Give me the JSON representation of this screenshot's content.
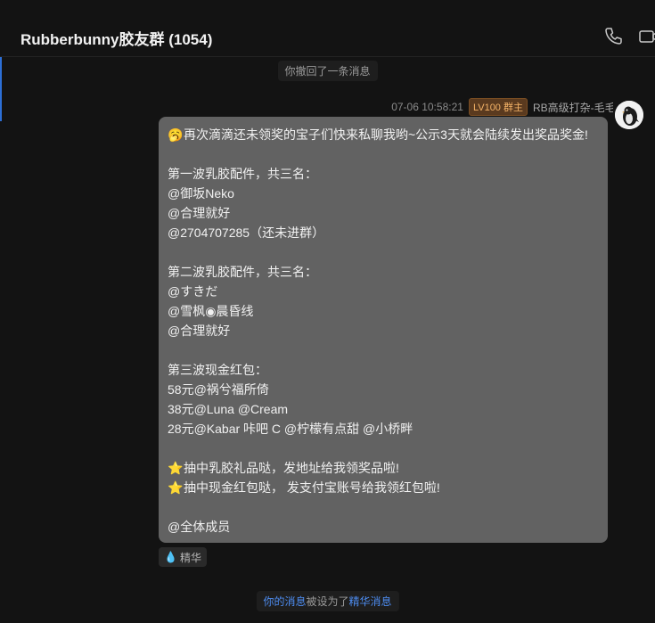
{
  "header": {
    "title": "Rubberbunny胶友群 (1054)",
    "phone_icon": "phone-icon",
    "video_icon": "video-icon"
  },
  "notices": {
    "recall_text": "你撤回了一条消息",
    "essence_prefix": "你的消息",
    "essence_mid": "被设为了",
    "essence_link": "精华消息"
  },
  "message": {
    "timestamp": "07-06 10:58:21",
    "level_badge": "LV100 群主",
    "sender": "RB高级打杂-毛毛",
    "lines": [
      {
        "emoji": "🥱",
        "text": "再次滴滴还未领奖的宝子们快来私聊我哟~公示3天就会陆续发出奖品奖金!"
      },
      {
        "text": ""
      },
      {
        "text": "第一波乳胶配件，共三名："
      },
      {
        "text": "@御坂Neko"
      },
      {
        "text": "@合理就好"
      },
      {
        "text": "@2704707285（还未进群）"
      },
      {
        "text": ""
      },
      {
        "text": "第二波乳胶配件，共三名："
      },
      {
        "text": "@すきだ"
      },
      {
        "text": "@雪枫◉晨昏线"
      },
      {
        "text": "@合理就好"
      },
      {
        "text": ""
      },
      {
        "text": "第三波现金红包："
      },
      {
        "text": "58元@祸兮福所倚"
      },
      {
        "text": "38元@Luna @Cream"
      },
      {
        "text": "28元@Kabar 咔吧 C @柠檬有点甜 @小桥畔"
      },
      {
        "text": ""
      },
      {
        "emoji": "⭐",
        "text": "抽中乳胶礼品哒，发地址给我领奖品啦!"
      },
      {
        "emoji": "⭐",
        "text": "抽中现金红包哒， 发支付宝账号给我领红包啦!"
      },
      {
        "text": ""
      },
      {
        "text": "@全体成员"
      }
    ],
    "essence_tag": "精华"
  },
  "colors": {
    "background": "#131313",
    "bubble": "#626262",
    "accent_blue": "#4d8cf0",
    "badge_bg": "#5a3a1f",
    "badge_text": "#f3b267"
  }
}
